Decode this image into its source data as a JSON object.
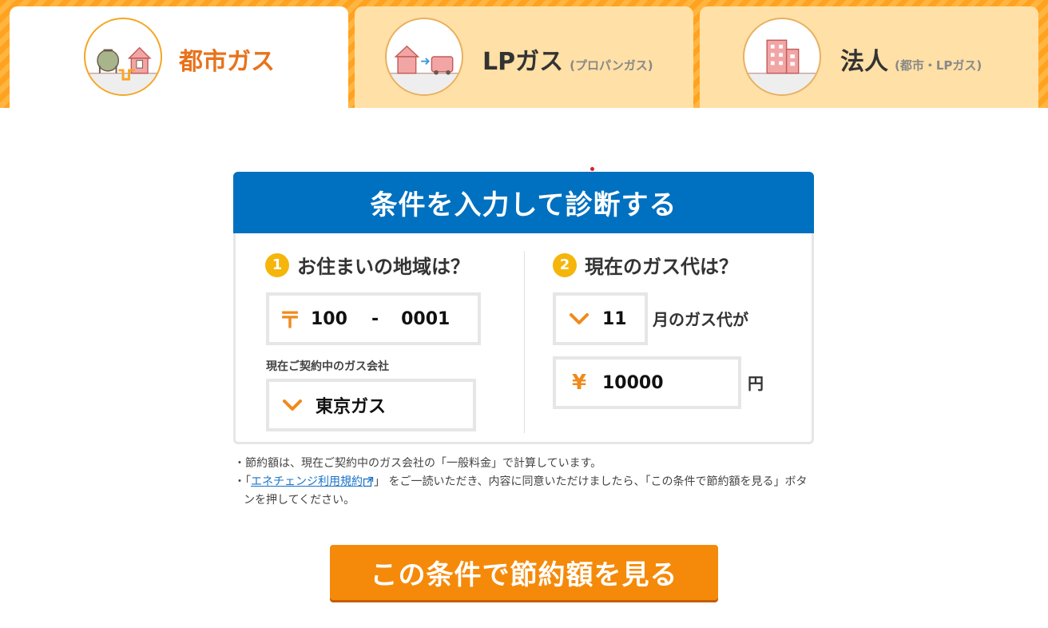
{
  "tabs": [
    {
      "label": "都市ガス",
      "sub": "",
      "icon": "gas-tank-house-icon"
    },
    {
      "label": "LPガス",
      "sub": "(プロパンガス)",
      "icon": "house-propane-truck-icon"
    },
    {
      "label": "法人",
      "sub": "(都市・LPガス)",
      "icon": "office-building-icon"
    }
  ],
  "form": {
    "title": "条件を入力して診断する",
    "q1": {
      "num": "1",
      "title": "お住まいの地域は？"
    },
    "postal": {
      "first": "100",
      "dash": "-",
      "second": "0001",
      "icon": "〒"
    },
    "company": {
      "label": "現在ご契約中のガス会社",
      "value": "東京ガス"
    },
    "q2": {
      "num": "2",
      "title": "現在のガス代は？"
    },
    "month": {
      "value": "11",
      "suffix": "月のガス代が"
    },
    "amount": {
      "icon": "¥",
      "value": "10000",
      "suffix": "円"
    }
  },
  "notes": {
    "note1": "・節約額は、現在ご契約中のガス会社の「一般料金」で計算しています。",
    "note2_prefix": "・「",
    "note2_link": "エネチェンジ利用規約",
    "note2_suffix": "」 をご一読いただき、内容に同意いただけましたら、「この条件で節約額を見る」ボタンを押してください。"
  },
  "cta": {
    "label": "この条件で節約額を見る"
  },
  "colors": {
    "accent_orange": "#f58a0a",
    "header_blue": "#0070c0",
    "badge_yellow": "#f5b50a",
    "active_tab_text": "#e8731c"
  }
}
